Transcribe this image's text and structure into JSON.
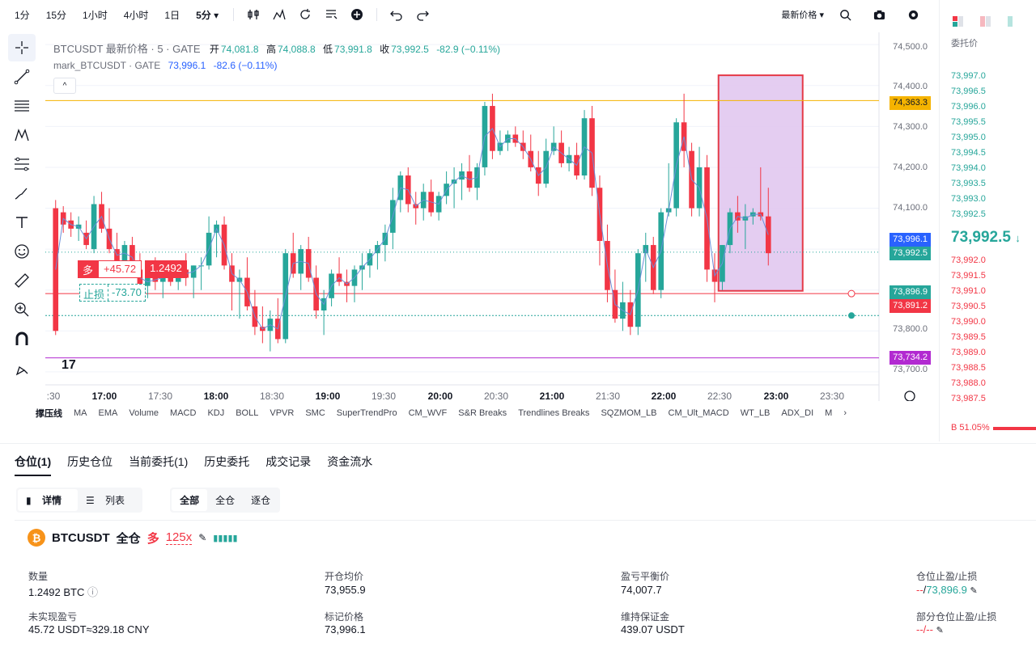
{
  "toolbar": {
    "timeframes": [
      "1分",
      "15分",
      "1小时",
      "4小时",
      "1日",
      "5分"
    ],
    "active_timeframe": "5分",
    "price_type": "最新价格"
  },
  "chart": {
    "legend_title": "BTCUSDT 最新价格 · 5 · GATE",
    "o_label": "开",
    "o": "74,081.8",
    "h_label": "高",
    "h": "74,088.8",
    "l_label": "低",
    "l": "73,991.8",
    "c_label": "收",
    "c": "73,992.5",
    "chg": "-82.9 (−0.11%)",
    "mark_name": "mark_BTCUSDT · GATE",
    "mark_price": "73,996.1",
    "mark_chg": "-82.6 (−0.11%)",
    "long_side": "多",
    "long_pnl": "+45.72",
    "long_qty": "1.2492",
    "sl_side": "止损",
    "sl_val": "-73.70",
    "price_ticks": [
      "74,500.0",
      "74,400.0",
      "74,300.0",
      "74,200.0",
      "74,100.0",
      "73,800.0",
      "73,700.0"
    ],
    "price_labels": {
      "orange": "74,363.3",
      "mark": "73,996.1",
      "last": "73,992.5",
      "sl": "73,896.9",
      "entry": "73,891.2",
      "purple": "73,734.2"
    },
    "time_ticks": [
      ":30",
      "17:00",
      "17:30",
      "18:00",
      "18:30",
      "19:00",
      "19:30",
      "20:00",
      "20:30",
      "21:00",
      "21:30",
      "22:00",
      "22:30",
      "23:00",
      "23:30"
    ],
    "colors": {
      "up": "#26a69a",
      "down": "#f23645",
      "orange": "#f5b300",
      "purple": "#b22ad1",
      "box": "#e1c8f0"
    }
  },
  "chart_data": {
    "type": "candlestick",
    "ylim": [
      73680,
      74530
    ],
    "candles": [
      [
        74100,
        74120,
        73790,
        73800
      ],
      [
        74090,
        74105,
        74040,
        74060
      ],
      [
        74070,
        74090,
        74030,
        74050
      ],
      [
        74050,
        74080,
        74020,
        74060
      ],
      [
        74040,
        74070,
        74000,
        74010
      ],
      [
        74000,
        74130,
        73990,
        74110
      ],
      [
        74110,
        74140,
        74040,
        74050
      ],
      [
        74050,
        74100,
        73990,
        74000
      ],
      [
        74000,
        74040,
        73950,
        73970
      ],
      [
        73970,
        74020,
        73940,
        74010
      ],
      [
        74010,
        74030,
        73940,
        73950
      ],
      [
        73950,
        73990,
        73880,
        73910
      ],
      [
        73910,
        73960,
        73880,
        73930
      ],
      [
        73930,
        73980,
        73900,
        73920
      ],
      [
        73920,
        73950,
        73880,
        73940
      ],
      [
        73940,
        73960,
        73910,
        73920
      ],
      [
        73920,
        73960,
        73900,
        73950
      ],
      [
        73950,
        73990,
        73910,
        73930
      ],
      [
        73930,
        73960,
        73880,
        73960
      ],
      [
        73960,
        73980,
        73900,
        73960
      ],
      [
        73960,
        74080,
        73950,
        74040
      ],
      [
        74040,
        74070,
        73980,
        74060
      ],
      [
        74060,
        74080,
        73950,
        73960
      ],
      [
        73960,
        73990,
        73850,
        73920
      ],
      [
        73920,
        73950,
        73830,
        73930
      ],
      [
        73930,
        73980,
        73850,
        73860
      ],
      [
        73860,
        73900,
        73790,
        73810
      ],
      [
        73810,
        73860,
        73770,
        73800
      ],
      [
        73800,
        73850,
        73750,
        73830
      ],
      [
        73830,
        73880,
        73770,
        73780
      ],
      [
        73780,
        74000,
        73770,
        73990
      ],
      [
        73990,
        74040,
        73930,
        73940
      ],
      [
        73940,
        74010,
        73900,
        74000
      ],
      [
        74000,
        74030,
        73920,
        73930
      ],
      [
        73930,
        73960,
        73830,
        73850
      ],
      [
        73850,
        73900,
        73790,
        73880
      ],
      [
        73880,
        73950,
        73860,
        73940
      ],
      [
        73940,
        73980,
        73910,
        73920
      ],
      [
        73920,
        73950,
        73870,
        73910
      ],
      [
        73910,
        73960,
        73870,
        73950
      ],
      [
        73950,
        73990,
        73900,
        73960
      ],
      [
        73960,
        74000,
        73930,
        73990
      ],
      [
        73990,
        74020,
        73950,
        74010
      ],
      [
        74010,
        74060,
        73970,
        74040
      ],
      [
        74040,
        74150,
        74000,
        74120
      ],
      [
        74120,
        74190,
        74090,
        74180
      ],
      [
        74180,
        74200,
        74090,
        74110
      ],
      [
        74110,
        74140,
        74060,
        74100
      ],
      [
        74100,
        74160,
        74070,
        74140
      ],
      [
        74140,
        74170,
        74080,
        74090
      ],
      [
        74090,
        74140,
        74070,
        74130
      ],
      [
        74130,
        74190,
        74110,
        74160
      ],
      [
        74160,
        74200,
        74100,
        74170
      ],
      [
        74170,
        74210,
        74120,
        74190
      ],
      [
        74190,
        74230,
        74140,
        74150
      ],
      [
        74150,
        74210,
        74120,
        74200
      ],
      [
        74200,
        74360,
        74180,
        74350
      ],
      [
        74350,
        74380,
        74220,
        74240
      ],
      [
        74240,
        74290,
        74230,
        74260
      ],
      [
        74260,
        74290,
        74240,
        74280
      ],
      [
        74280,
        74300,
        74250,
        74260
      ],
      [
        74260,
        74290,
        74220,
        74240
      ],
      [
        74240,
        74280,
        74190,
        74200
      ],
      [
        74200,
        74240,
        74130,
        74160
      ],
      [
        74160,
        74270,
        74150,
        74240
      ],
      [
        74240,
        74300,
        74230,
        74260
      ],
      [
        74260,
        74290,
        74200,
        74210
      ],
      [
        74210,
        74250,
        74190,
        74230
      ],
      [
        74230,
        74260,
        74170,
        74180
      ],
      [
        74180,
        74340,
        74170,
        74320
      ],
      [
        74320,
        74350,
        74130,
        74150
      ],
      [
        74150,
        74180,
        73960,
        74020
      ],
      [
        74020,
        74060,
        73870,
        73900
      ],
      [
        73900,
        73950,
        73820,
        73830
      ],
      [
        73830,
        73920,
        73800,
        73870
      ],
      [
        73870,
        73900,
        73790,
        73810
      ],
      [
        73810,
        74000,
        73790,
        73990
      ],
      [
        73990,
        74040,
        73920,
        74010
      ],
      [
        74010,
        74030,
        73890,
        73900
      ],
      [
        73900,
        74100,
        73880,
        74090
      ],
      [
        74090,
        74210,
        74080,
        74100
      ],
      [
        74100,
        74320,
        74080,
        74310
      ],
      [
        74310,
        74380,
        74200,
        74240
      ],
      [
        74240,
        74260,
        74080,
        74100
      ],
      [
        74100,
        74250,
        74080,
        74200
      ],
      [
        74200,
        74230,
        73920,
        73950
      ],
      [
        73950,
        73990,
        73870,
        73920
      ],
      [
        73920,
        74010,
        73900,
        74010
      ],
      [
        74010,
        74100,
        73990,
        74090
      ],
      [
        74090,
        74130,
        74040,
        74070
      ],
      [
        74070,
        74110,
        74000,
        74080
      ],
      [
        74080,
        74100,
        74060,
        74090
      ],
      [
        74090,
        74200,
        74070,
        74080
      ],
      [
        74080,
        74150,
        73960,
        73990
      ]
    ]
  },
  "indicators": [
    "撑压线",
    "MA",
    "EMA",
    "Volume",
    "MACD",
    "KDJ",
    "BOLL",
    "VPVR",
    "SMC",
    "SuperTrendPro",
    "CM_WVF",
    "S&R Breaks",
    "Trendlines Breaks",
    "SQZMOM_LB",
    "CM_Ult_MACD",
    "WT_LB",
    "ADX_DI",
    "M"
  ],
  "orderbook": {
    "header": "委托价",
    "asks": [
      "73,997.0",
      "73,996.5",
      "73,996.0",
      "73,995.5",
      "73,995.0",
      "73,994.5",
      "73,994.0",
      "73,993.5",
      "73,993.0",
      "73,992.5"
    ],
    "last": "73,992.5",
    "bids": [
      "73,992.0",
      "73,991.5",
      "73,991.0",
      "73,990.5",
      "73,990.0",
      "73,989.5",
      "73,989.0",
      "73,988.5",
      "73,988.0",
      "73,987.5"
    ],
    "buy_ratio": "B 51.05%"
  },
  "bottom": {
    "tabs": [
      "仓位(1)",
      "历史仓位",
      "当前委托(1)",
      "历史委托",
      "成交记录",
      "资金流水"
    ],
    "view_modes": [
      "详情",
      "列表"
    ],
    "filters": [
      "全部",
      "全仓",
      "逐仓"
    ],
    "symbol": "BTCUSDT",
    "margin_mode": "全仓",
    "side": "多",
    "leverage": "125x",
    "fields": {
      "qty_label": "数量",
      "qty": "1.2492 BTC",
      "pnl_label": "未实现盈亏",
      "pnl": "45.72 USDT≈329.18 CNY",
      "entry_label": "开仓均价",
      "entry": "73,955.9",
      "mark_label": "标记价格",
      "mark": "73,996.1",
      "be_label": "盈亏平衡价",
      "be": "74,007.7",
      "mm_label": "维持保证金",
      "mm": "439.07 USDT",
      "tpsl_label": "仓位止盈/止损",
      "tpsl_tp": "--",
      "tpsl_sl": "73,896.9",
      "ptpsl_label": "部分仓位止盈/止损",
      "ptpsl": "--/--"
    }
  }
}
